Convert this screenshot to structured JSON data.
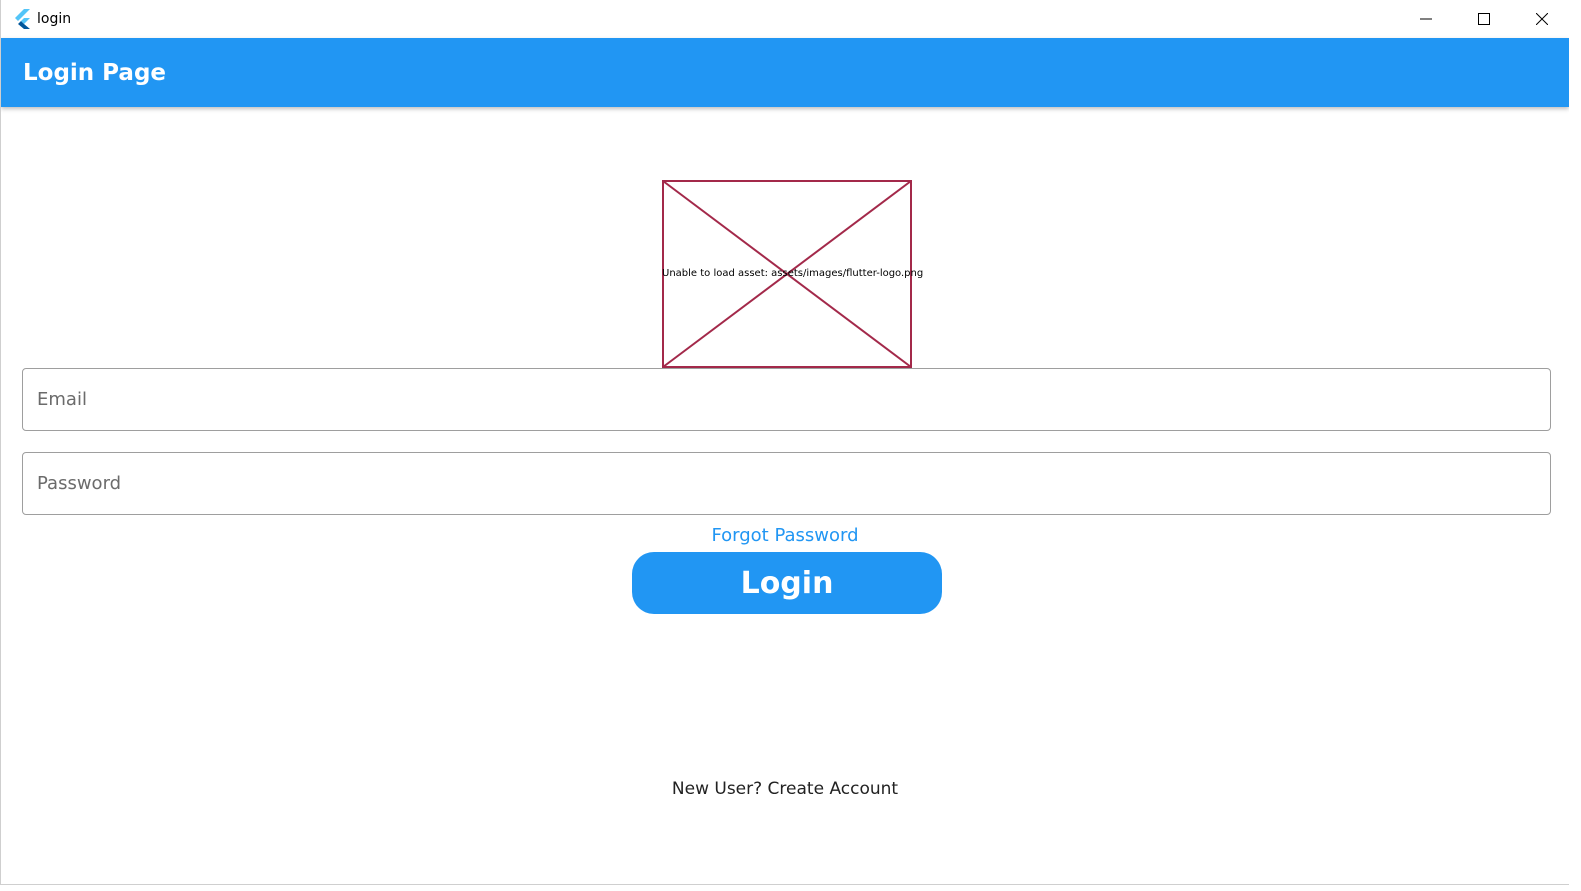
{
  "window": {
    "title": "login",
    "controls": {
      "minimize_icon": "minimize-icon",
      "maximize_icon": "maximize-icon",
      "close_icon": "close-icon"
    }
  },
  "appbar": {
    "title": "Login Page",
    "color": "#2196f3"
  },
  "logo_image": {
    "error_text": "Unable to load asset: assets/images/flutter-logo.png",
    "border_color": "#a3294a"
  },
  "form": {
    "email_placeholder": "Email",
    "password_placeholder": "Password",
    "forgot_password_label": "Forgot Password",
    "login_button_label": "Login",
    "create_account_label": "New User? Create Account"
  },
  "colors": {
    "accent": "#2196f3",
    "field_border": "#9e9e9e"
  }
}
